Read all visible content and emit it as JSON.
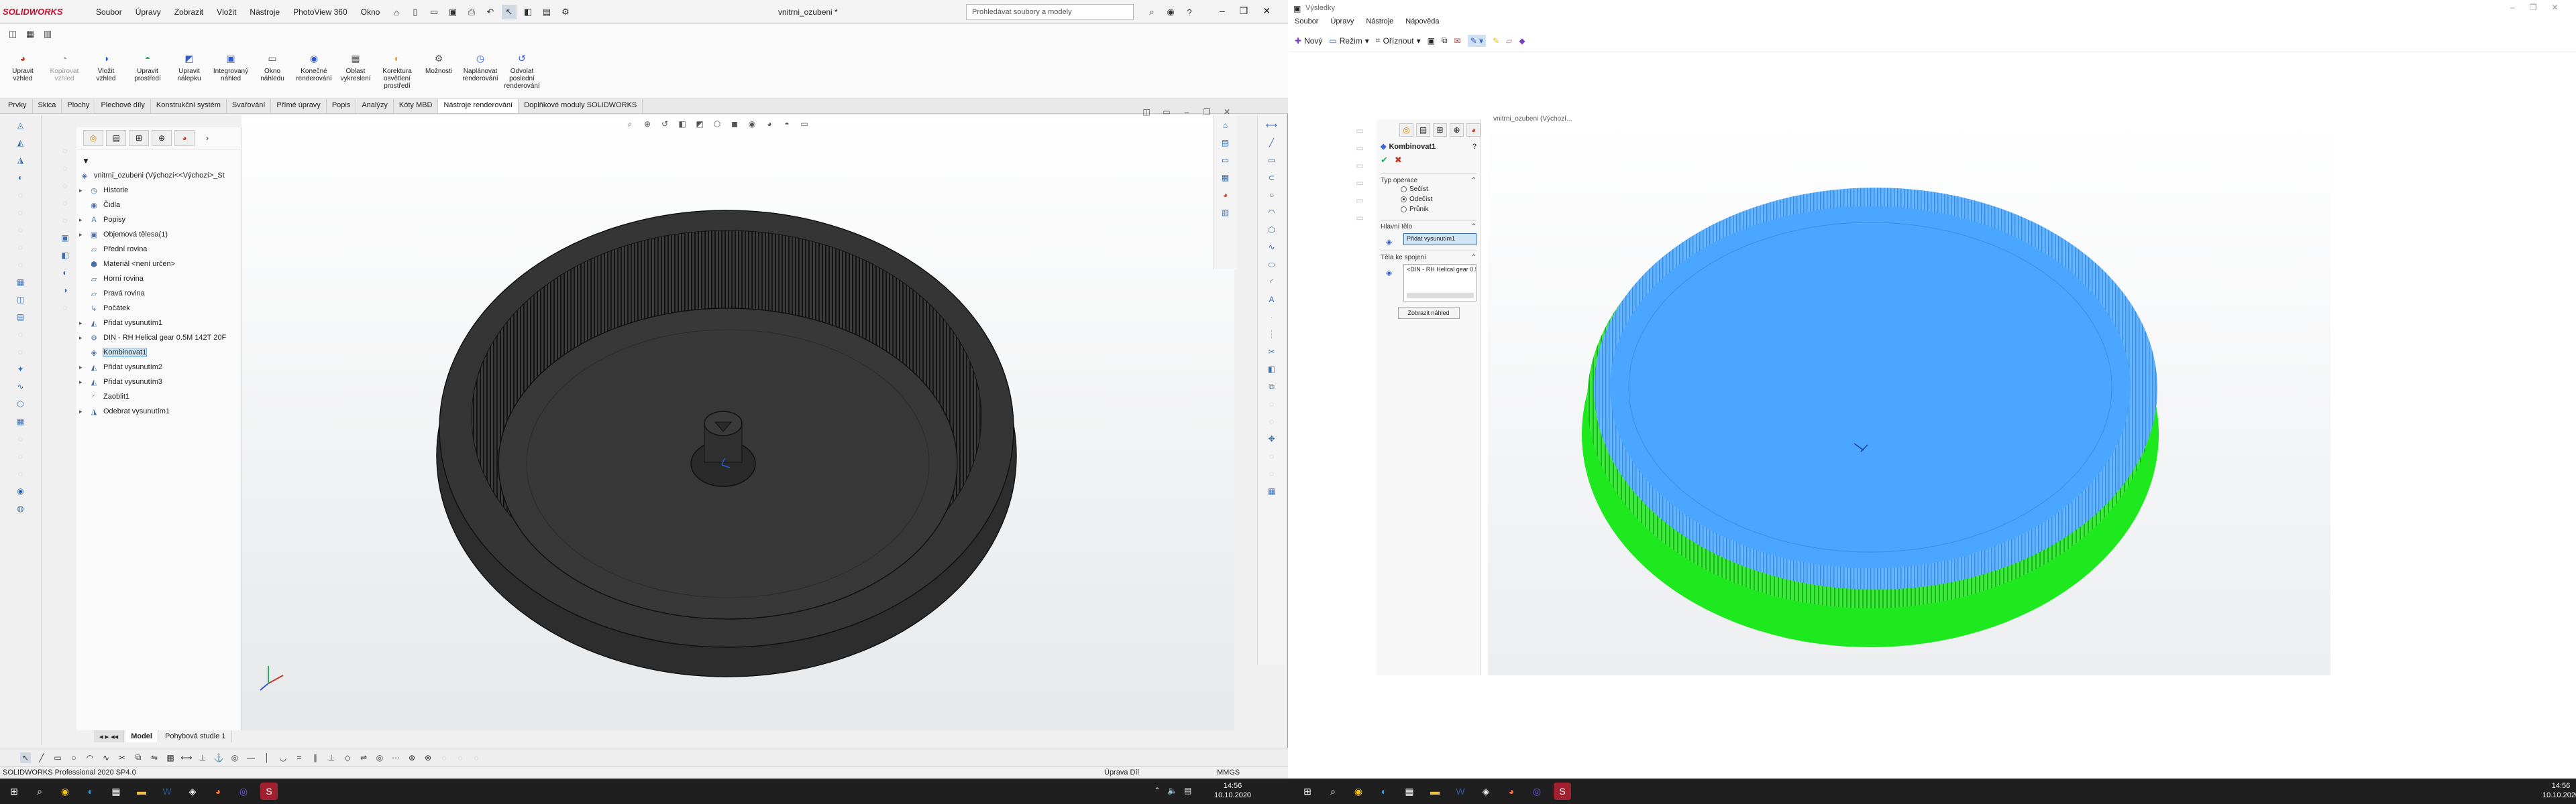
{
  "left_window": {
    "logo": "SOLIDWORKS",
    "menu": [
      "Soubor",
      "Úpravy",
      "Zobrazit",
      "Vložit",
      "Nástroje",
      "PhotoView 360",
      "Okno"
    ],
    "document_title": "vnitrni_ozubeni *",
    "search_placeholder": "Prohledávat soubory a modely",
    "ribbon_tools": [
      {
        "label": "Upravit vzhled",
        "icon": "appearance-icon",
        "enabled": true
      },
      {
        "label": "Kopírovat vzhled",
        "icon": "copy-appearance-icon",
        "enabled": false
      },
      {
        "label": "Vložit vzhled",
        "icon": "paste-appearance-icon",
        "enabled": true
      },
      {
        "label": "Upravit prostředí",
        "icon": "scene-icon",
        "enabled": true
      },
      {
        "label": "Upravit nálepku",
        "icon": "decal-icon",
        "enabled": true
      },
      {
        "label": "Integrovaný náhled",
        "icon": "integrated-preview-icon",
        "enabled": true
      },
      {
        "label": "Okno náhledu",
        "icon": "preview-window-icon",
        "enabled": true
      },
      {
        "label": "Konečné renderování",
        "icon": "final-render-icon",
        "enabled": true
      },
      {
        "label": "Oblast vykreslení",
        "icon": "render-region-icon",
        "enabled": true
      },
      {
        "label": "Korektura osvětlení prostředí",
        "icon": "lighting-icon",
        "enabled": true
      },
      {
        "label": "Možnosti",
        "icon": "options-icon",
        "enabled": true
      },
      {
        "label": "Naplánovat renderování",
        "icon": "schedule-render-icon",
        "enabled": true
      },
      {
        "label": "Odvolat poslední renderování",
        "icon": "recall-render-icon",
        "enabled": true
      }
    ],
    "tabs": [
      "Prvky",
      "Skica",
      "Plochy",
      "Plechové díly",
      "Konstrukční systém",
      "Svařování",
      "Přímé úpravy",
      "Popis",
      "Analýzy",
      "Kóty MBD",
      "Nástroje renderování",
      "Doplňkové moduly SOLIDWORKS"
    ],
    "active_tab": "Nástroje renderování",
    "tree_root": "vnitrni_ozubeni  (Výchozí<<Výchozí>_St",
    "tree": [
      {
        "label": "Historie",
        "icon": "history-icon",
        "expandable": true
      },
      {
        "label": "Čidla",
        "icon": "sensor-icon",
        "expandable": false
      },
      {
        "label": "Popisy",
        "icon": "annotation-icon",
        "expandable": true
      },
      {
        "label": "Objemová tělesa(1)",
        "icon": "solid-bodies-icon",
        "expandable": true
      },
      {
        "label": "Přední rovina",
        "icon": "plane-icon",
        "expandable": false
      },
      {
        "label": "Materiál <není určen>",
        "icon": "material-icon",
        "expandable": false
      },
      {
        "label": "Horní rovina",
        "icon": "plane-icon",
        "expandable": false
      },
      {
        "label": "Pravá rovina",
        "icon": "plane-icon",
        "expandable": false
      },
      {
        "label": "Počátek",
        "icon": "origin-icon",
        "expandable": false
      },
      {
        "label": "Přidat vysunutím1",
        "icon": "extrude-icon",
        "expandable": true
      },
      {
        "label": "DIN - RH Helical gear 0.5M 142T 20F",
        "icon": "gear-part-icon",
        "expandable": true
      },
      {
        "label": "Kombinovat1",
        "icon": "combine-icon",
        "expandable": false,
        "selected": true
      },
      {
        "label": "Přidat vysunutím2",
        "icon": "extrude-icon",
        "expandable": true
      },
      {
        "label": "Přidat vysunutím3",
        "icon": "extrude-icon",
        "expandable": true
      },
      {
        "label": "Zaoblit1",
        "icon": "fillet-icon",
        "expandable": false
      },
      {
        "label": "Odebrat vysunutím1",
        "icon": "cut-extrude-icon",
        "expandable": true
      }
    ],
    "bottom_tabs": [
      "Model",
      "Pohybová studie 1"
    ],
    "status_left": "SOLIDWORKS Professional 2020 SP4.0",
    "status_mid": "Úprava Díl",
    "status_units": "MMGS"
  },
  "right_window": {
    "title": "Výsledky",
    "menu": [
      "Soubor",
      "Úpravy",
      "Nástroje",
      "Nápověda"
    ],
    "toolbar": {
      "new": "Nový",
      "mode": "Režim",
      "crop": "Oříznout"
    },
    "view_caption": "vnitrni_ozubeni  (Výchozí...",
    "panel": {
      "feature_title": "Kombinovat1",
      "operation_header": "Typ operace",
      "operations": [
        {
          "label": "Sečíst",
          "checked": false
        },
        {
          "label": "Odečíst",
          "checked": true
        },
        {
          "label": "Průnik",
          "checked": false
        }
      ],
      "main_body_header": "Hlavní tělo",
      "main_body_value": "Přidat vysunutím1",
      "subtract_header": "Těla ke spojení",
      "subtract_value": "<DIN - RH Helical gear 0.5M 142T",
      "preview_button": "Zobrazit náhled"
    }
  },
  "taskbar": {
    "time": "14:56",
    "date": "10.10.2020"
  },
  "colors": {
    "gear_dark": "#2b2b2b",
    "preview_green": "#1ee81e",
    "preview_blue": "#4aa6ff",
    "tree_selected": "#cde6f7",
    "solidworks_red": "#c8102e"
  }
}
